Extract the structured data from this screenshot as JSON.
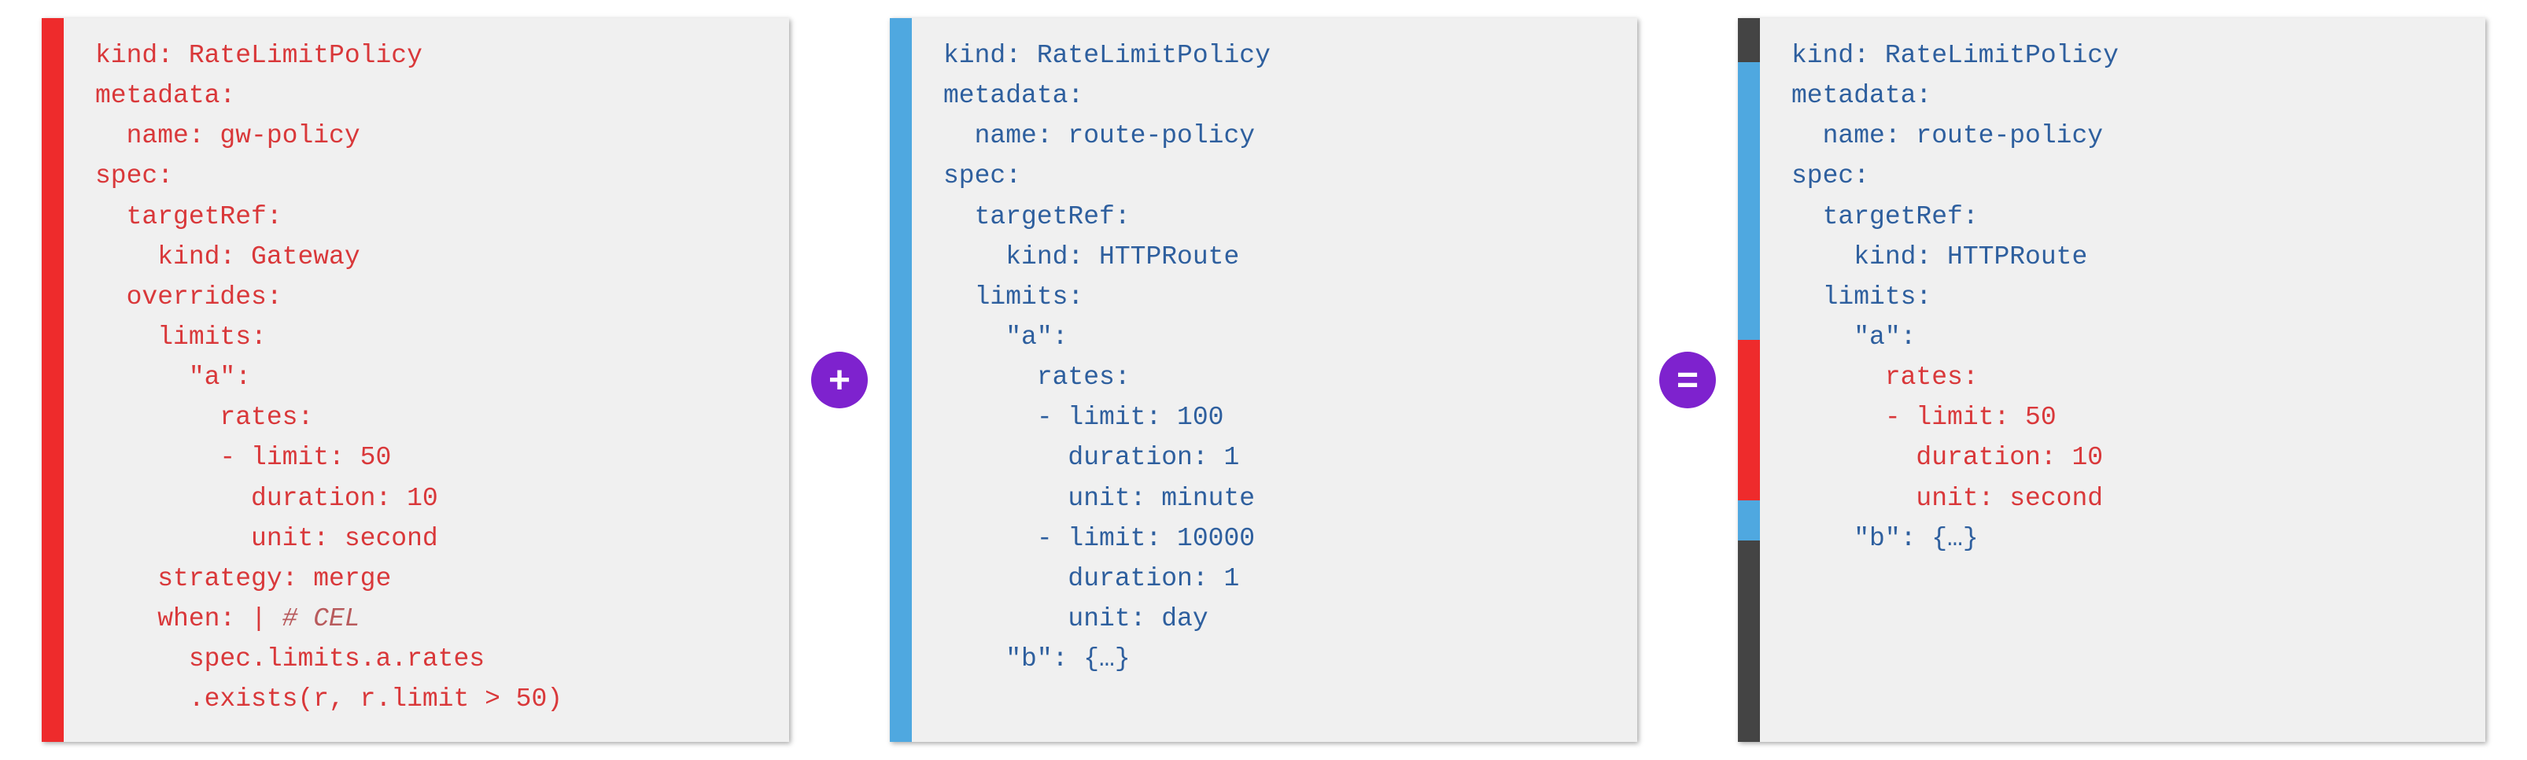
{
  "panel1": {
    "accent": "#ee2b2c",
    "color": "red",
    "lines": [
      {
        "t": "kind: RateLimitPolicy",
        "i": 0
      },
      {
        "t": "metadata:",
        "i": 0
      },
      {
        "t": "name: gw-policy",
        "i": 1
      },
      {
        "t": "spec:",
        "i": 0
      },
      {
        "t": "targetRef:",
        "i": 1
      },
      {
        "t": "kind: Gateway",
        "i": 2
      },
      {
        "t": "overrides:",
        "i": 1
      },
      {
        "t": "limits:",
        "i": 2
      },
      {
        "t": "\"a\":",
        "i": 3
      },
      {
        "t": "rates:",
        "i": 4
      },
      {
        "t": "- limit: 50",
        "i": 4
      },
      {
        "t": "  duration: 10",
        "i": 4
      },
      {
        "t": "  unit: second",
        "i": 4
      },
      {
        "t": "strategy: merge",
        "i": 2
      },
      {
        "t": "when: | ",
        "i": 2,
        "comment": "# CEL"
      },
      {
        "t": "spec.limits.a.rates",
        "i": 3
      },
      {
        "t": ".exists(r, r.limit > 50)",
        "i": 3
      }
    ]
  },
  "op1": "+",
  "panel2": {
    "accent": "#4fa8e0",
    "color": "blue",
    "lines": [
      {
        "t": "kind: RateLimitPolicy",
        "i": 0
      },
      {
        "t": "metadata:",
        "i": 0
      },
      {
        "t": "name: route-policy",
        "i": 1
      },
      {
        "t": "spec:",
        "i": 0
      },
      {
        "t": "targetRef:",
        "i": 1
      },
      {
        "t": "kind: HTTPRoute",
        "i": 2
      },
      {
        "t": "limits:",
        "i": 1
      },
      {
        "t": "\"a\":",
        "i": 2
      },
      {
        "t": "rates:",
        "i": 3
      },
      {
        "t": "- limit: 100",
        "i": 3
      },
      {
        "t": "  duration: 1",
        "i": 3
      },
      {
        "t": "  unit: minute",
        "i": 3
      },
      {
        "t": "- limit: 10000",
        "i": 3
      },
      {
        "t": "  duration: 1",
        "i": 3
      },
      {
        "t": "  unit: day",
        "i": 3
      },
      {
        "t": "\"b\": {…}",
        "i": 2
      }
    ]
  },
  "op2": "=",
  "panel3": {
    "segments": [
      {
        "color": "#444444",
        "flex": 1.1
      },
      {
        "color": "#4fa8e0",
        "flex": 6.9
      },
      {
        "color": "#ee2b2c",
        "flex": 4.0
      },
      {
        "color": "#4fa8e0",
        "flex": 1.0
      },
      {
        "color": "#444444",
        "flex": 5.0
      }
    ],
    "lines": [
      {
        "t": "kind: RateLimitPolicy",
        "i": 0,
        "c": "blue"
      },
      {
        "t": "metadata:",
        "i": 0,
        "c": "blue"
      },
      {
        "t": "name: route-policy",
        "i": 1,
        "c": "blue"
      },
      {
        "t": "spec:",
        "i": 0,
        "c": "blue"
      },
      {
        "t": "targetRef:",
        "i": 1,
        "c": "blue"
      },
      {
        "t": "kind: HTTPRoute",
        "i": 2,
        "c": "blue"
      },
      {
        "t": "limits:",
        "i": 1,
        "c": "blue"
      },
      {
        "t": "\"a\":",
        "i": 2,
        "c": "blue"
      },
      {
        "t": "rates:",
        "i": 3,
        "c": "red"
      },
      {
        "t": "- limit: 50",
        "i": 3,
        "c": "red"
      },
      {
        "t": "  duration: 10",
        "i": 3,
        "c": "red"
      },
      {
        "t": "  unit: second",
        "i": 3,
        "c": "red"
      },
      {
        "t": "\"b\": {…}",
        "i": 2,
        "c": "blue"
      }
    ]
  }
}
